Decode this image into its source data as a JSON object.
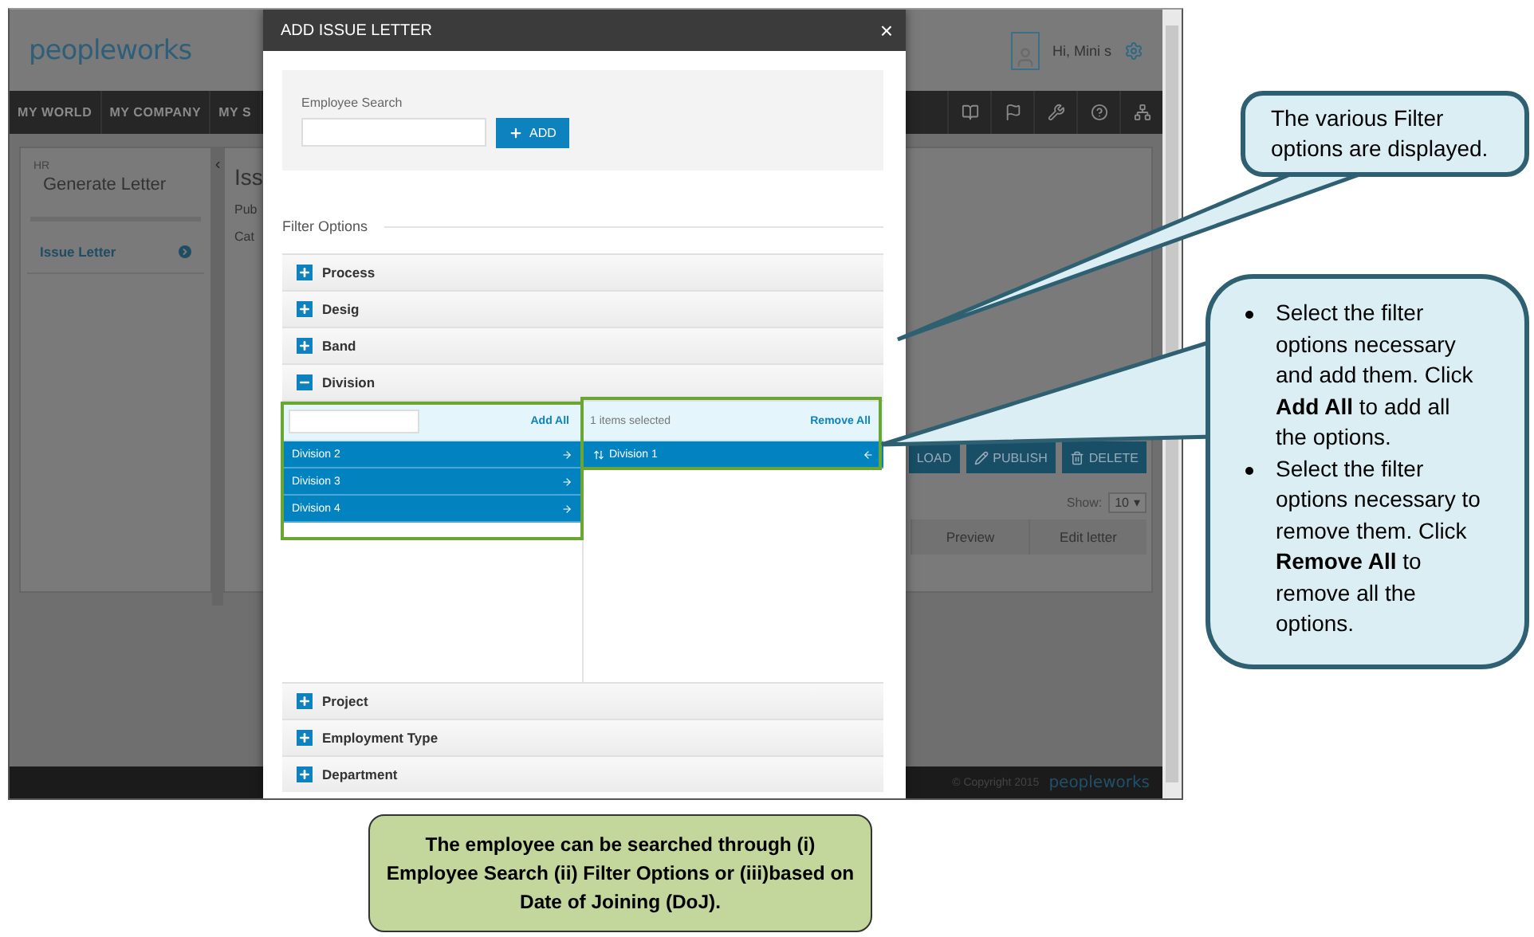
{
  "app": {
    "logo": "peopleworks",
    "greeting": "Hi, Mini s",
    "nav": [
      "MY WORLD",
      "MY COMPANY",
      "MY S"
    ],
    "sidebar": {
      "section": "HR",
      "title": "Generate Letter",
      "items": [
        "Issue Letter"
      ]
    },
    "main": {
      "heading": "Iss",
      "fields": [
        "Pub",
        "Cat"
      ],
      "buttons": [
        {
          "kind": "upload",
          "label": "LOAD"
        },
        {
          "kind": "publish",
          "label": "PUBLISH"
        },
        {
          "kind": "delete",
          "label": "DELETE"
        }
      ],
      "show_label": "Show:",
      "show_value": "10",
      "show_caret": "▾",
      "columns": [
        "Preview",
        "Edit letter"
      ]
    },
    "footer": {
      "copyright": "© Copyright 2015",
      "logo": "peopleworks"
    }
  },
  "dialog": {
    "title": "ADD ISSUE LETTER",
    "close": "×",
    "search": {
      "label": "Employee Search",
      "button": "ADD"
    },
    "filter_title": "Filter Options",
    "filters": [
      {
        "label": "Process",
        "expanded": false
      },
      {
        "label": "Desig",
        "expanded": false
      },
      {
        "label": "Band",
        "expanded": false
      },
      {
        "label": "Division",
        "expanded": true,
        "options": {
          "add_all": "Add All",
          "available": [
            "Division 2",
            "Division 3",
            "Division 4"
          ],
          "selected_count": "1 items selected",
          "remove_all": "Remove All",
          "selected": [
            "Division 1"
          ]
        }
      },
      {
        "label": "Project",
        "expanded": false
      },
      {
        "label": "Employment Type",
        "expanded": false
      },
      {
        "label": "Department",
        "expanded": false
      }
    ]
  },
  "callouts": [
    {
      "kind": "plain",
      "text": "The various Filter options are displayed."
    },
    {
      "kind": "bullets",
      "items": [
        "Select the filter options necessary and add them. Click **Add All** to add all the options.",
        "Select the filter options necessary to remove them. Click **Remove All** to remove all the options."
      ]
    }
  ],
  "note": "The employee can be searched through (i) Employee Search (ii) Filter Options or (iii)based on Date of Joining (DoJ)."
}
